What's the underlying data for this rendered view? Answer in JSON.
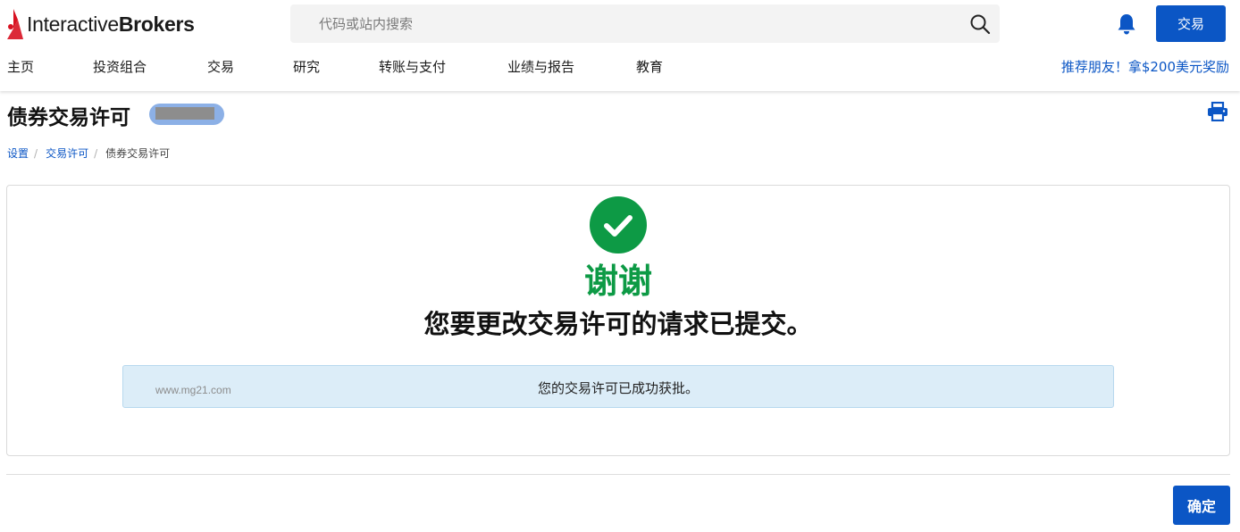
{
  "header": {
    "logo": {
      "text_regular": "Interactive",
      "text_bold": "Brokers"
    },
    "search": {
      "placeholder": "代码或站内搜索"
    },
    "trade_button": "交易",
    "nav": [
      "主页",
      "投资组合",
      "交易",
      "研究",
      "转账与支付",
      "业绩与报告",
      "教育"
    ],
    "promo": "推荐朋友！拿$200美元奖励"
  },
  "page": {
    "title": "债券交易许可",
    "breadcrumb": [
      "设置",
      "交易许可",
      "债券交易许可"
    ]
  },
  "confirmation": {
    "thanks": "谢谢",
    "message": "您要更改交易许可的请求已提交。",
    "info_text": "您的交易许可已成功获批。",
    "watermark": "www.mg21.com"
  },
  "footer": {
    "confirm_button": "确定"
  },
  "colors": {
    "brand_blue": "#0b56c5",
    "success_green": "#0d9a45",
    "logo_red": "#d81222",
    "info_bg": "#dcedf8"
  },
  "icons": [
    "ib-logo-mark",
    "search-icon",
    "bell-icon",
    "print-icon",
    "checkmark-icon"
  ]
}
